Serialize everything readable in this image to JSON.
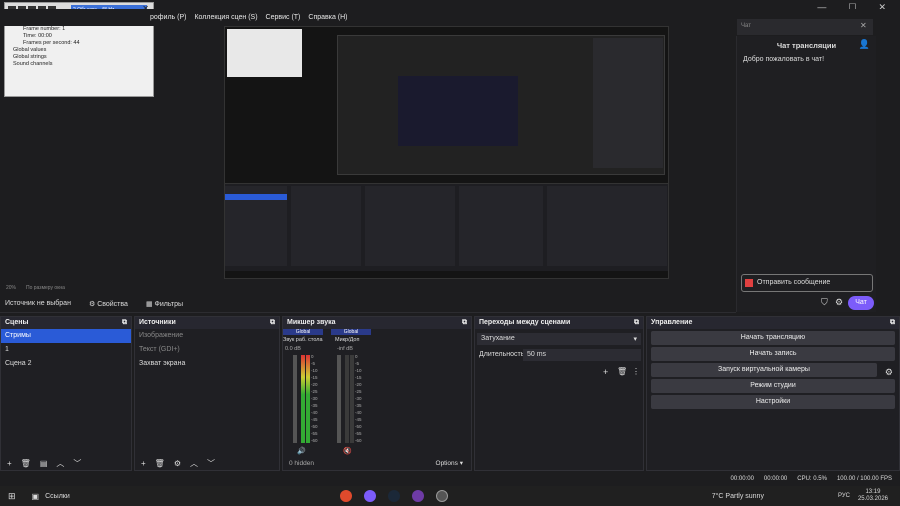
{
  "menu": {
    "items": [
      "рофиль (P)",
      "Коллекция сцен (S)",
      "Сервис (T)",
      "Справка (H)"
    ]
  },
  "debugger": {
    "title": "2 Объекта - 48 Hz",
    "tree": [
      "System",
      "Frame number: 1",
      "Time: 00:00",
      "Frames per second: 44",
      "Global values",
      "Global strings",
      "Sound channels"
    ]
  },
  "chat": {
    "search_placeholder": "Чат",
    "title": "Чат трансляции",
    "welcome": "Добро пожаловать в чат!",
    "send_placeholder": "Отправить сообщение",
    "send_label": "Чат"
  },
  "preview_status": {
    "zoom": "20%",
    "scale": "По размеру окна"
  },
  "source_bar": {
    "none": "Источник не выбран",
    "properties": "Свойства",
    "filters": "Фильтры"
  },
  "scenes": {
    "title": "Сцены",
    "items": [
      "Стримы",
      "1",
      "Сцена 2"
    ]
  },
  "sources": {
    "title": "Источники",
    "items": [
      "Изображение",
      "Текст (GDI+)",
      "Захват экрана"
    ]
  },
  "mixer": {
    "title": "Микшер звука",
    "ch1_top": "Global",
    "ch1_name": "Звук раб. стола",
    "ch1_db": "0.0 dB",
    "ch2_top": "Global",
    "ch2_name": "Микр/Доп",
    "ch2_db": "-inf dB",
    "scale": [
      "0",
      "-5",
      "-10",
      "-15",
      "-20",
      "-25",
      "-30",
      "-35",
      "-40",
      "-45",
      "-50",
      "-55",
      "-60"
    ],
    "hidden": "0 hidden",
    "options": "Options"
  },
  "transitions": {
    "title": "Переходы между сценами",
    "type": "Затухание",
    "duration_label": "Длительность",
    "duration_value": "50 ms"
  },
  "controls": {
    "title": "Управление",
    "buttons": [
      "Начать трансляцию",
      "Начать запись",
      "Запуск виртуальной камеры",
      "Режим студии",
      "Настройки"
    ]
  },
  "status": {
    "t1": "00:00:00",
    "t2": "00:00:00",
    "cpu": "CPU: 0.5%",
    "fps": "100.00 / 100.00 FPS"
  },
  "taskbar": {
    "label": "Ссылки",
    "weather": "7°C",
    "weather_desc": "Partly sunny",
    "lang": "РУС",
    "time": "13:19",
    "date": "25.03.2026"
  }
}
